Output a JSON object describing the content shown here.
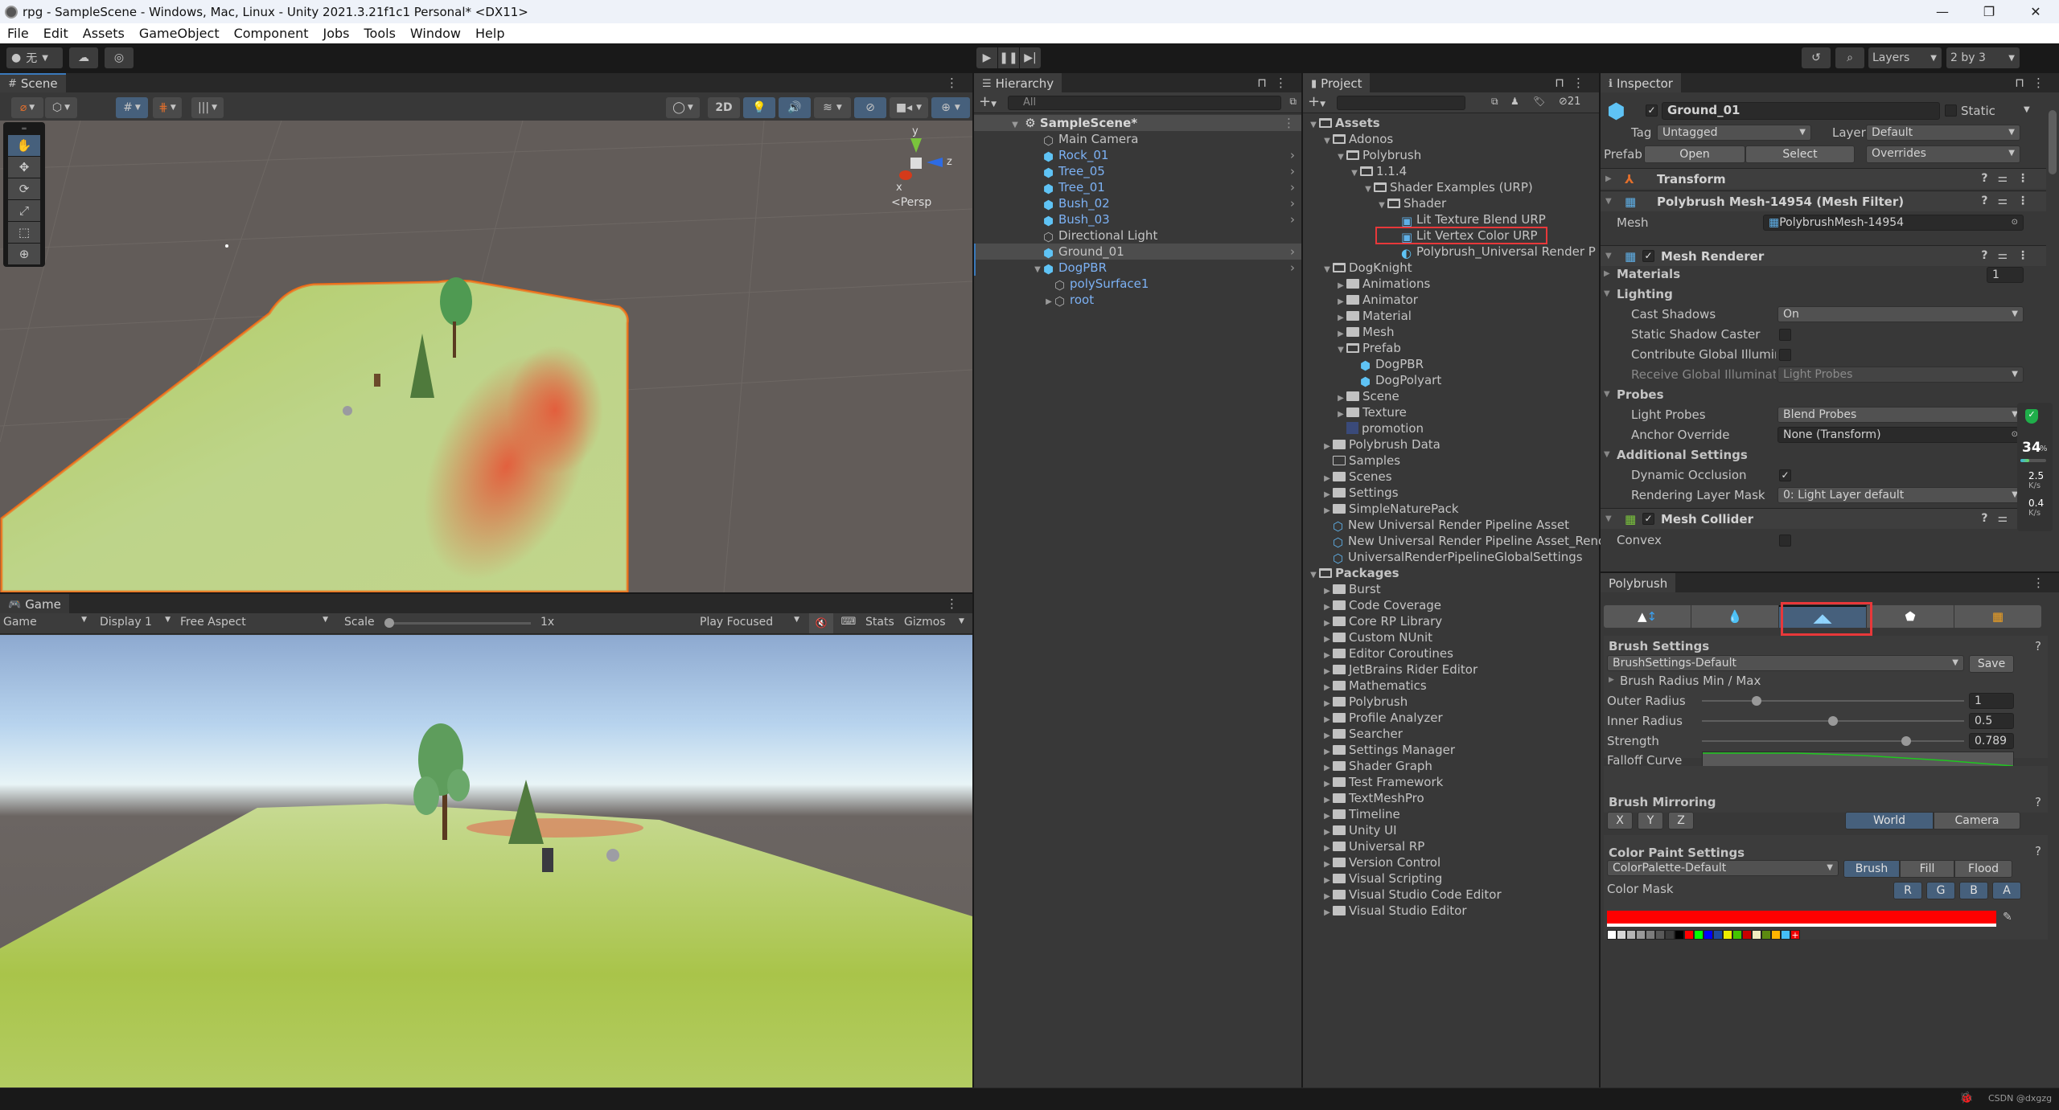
{
  "window": {
    "title": "rpg - SampleScene - Windows, Mac, Linux - Unity 2021.3.21f1c1 Personal* <DX11>",
    "controls": [
      "—",
      "❐",
      "✕"
    ]
  },
  "menu": [
    "File",
    "Edit",
    "Assets",
    "GameObject",
    "Component",
    "Jobs",
    "Tools",
    "Window",
    "Help"
  ],
  "toolbar": {
    "account_label": "无",
    "layers_label": "Layers",
    "layout_label": "2 by 3"
  },
  "scene": {
    "tab_label": "Scene",
    "btn_2d": "2D",
    "persp_label": "Persp",
    "gizmo_axes": {
      "x": "x",
      "y": "y",
      "z": "z"
    },
    "tools": [
      "hand-tool",
      "move-tool",
      "rotate-tool",
      "scale-tool",
      "rect-tool",
      "transform-tool"
    ]
  },
  "game": {
    "tab_label": "Game",
    "mode": "Game",
    "display": "Display 1",
    "aspect": "Free Aspect",
    "scale_label": "Scale",
    "scale_value": "1x",
    "play_mode": "Play Focused",
    "stats": "Stats",
    "gizmos": "Gizmos"
  },
  "hierarchy": {
    "tab_label": "Hierarchy",
    "search_placeholder": "All",
    "scene_name": "SampleScene*",
    "items": [
      {
        "label": "Main Camera",
        "prefab": false,
        "depth": 1,
        "chevron": false
      },
      {
        "label": "Rock_01",
        "prefab": true,
        "depth": 1,
        "chevron": true
      },
      {
        "label": "Tree_05",
        "prefab": true,
        "depth": 1,
        "chevron": true
      },
      {
        "label": "Tree_01",
        "prefab": true,
        "depth": 1,
        "chevron": true
      },
      {
        "label": "Bush_02",
        "prefab": true,
        "depth": 1,
        "chevron": true
      },
      {
        "label": "Bush_03",
        "prefab": true,
        "depth": 1,
        "chevron": true
      },
      {
        "label": "Directional Light",
        "prefab": false,
        "depth": 1,
        "chevron": false
      },
      {
        "label": "Ground_01",
        "prefab": true,
        "depth": 1,
        "chevron": true,
        "selected": true,
        "plain": true
      },
      {
        "label": "DogPBR",
        "prefab": true,
        "depth": 1,
        "chevron": true,
        "expanded": true
      },
      {
        "label": "polySurface1",
        "prefab": true,
        "depth": 2,
        "chevron": false,
        "child": true
      },
      {
        "label": "root",
        "prefab": true,
        "depth": 2,
        "chevron": false,
        "child": true,
        "collapsed": true
      }
    ]
  },
  "project": {
    "tab_label": "Project",
    "hidden_count": "21",
    "tree": [
      {
        "label": "Assets",
        "depth": 0,
        "type": "open",
        "bold": true
      },
      {
        "label": "Adonos",
        "depth": 1,
        "type": "open"
      },
      {
        "label": "Polybrush",
        "depth": 2,
        "type": "open"
      },
      {
        "label": "1.1.4",
        "depth": 3,
        "type": "open"
      },
      {
        "label": "Shader Examples (URP)",
        "depth": 4,
        "type": "open"
      },
      {
        "label": "Shader",
        "depth": 5,
        "type": "open"
      },
      {
        "label": "Lit Texture Blend URP",
        "depth": 6,
        "type": "shader"
      },
      {
        "label": "Lit Vertex Color URP",
        "depth": 6,
        "type": "shader",
        "highlighted": true
      },
      {
        "label": "Polybrush_Universal Render P",
        "depth": 6,
        "type": "material"
      },
      {
        "label": "DogKnight",
        "depth": 1,
        "type": "open"
      },
      {
        "label": "Animations",
        "depth": 2,
        "type": "closed"
      },
      {
        "label": "Animator",
        "depth": 2,
        "type": "closed"
      },
      {
        "label": "Material",
        "depth": 2,
        "type": "closed"
      },
      {
        "label": "Mesh",
        "depth": 2,
        "type": "closed"
      },
      {
        "label": "Prefab",
        "depth": 2,
        "type": "open"
      },
      {
        "label": "DogPBR",
        "depth": 3,
        "type": "prefab"
      },
      {
        "label": "DogPolyart",
        "depth": 3,
        "type": "prefab"
      },
      {
        "label": "Scene",
        "depth": 2,
        "type": "closed"
      },
      {
        "label": "Texture",
        "depth": 2,
        "type": "closed"
      },
      {
        "label": "promotion",
        "depth": 2,
        "type": "image"
      },
      {
        "label": "Polybrush Data",
        "depth": 1,
        "type": "closed"
      },
      {
        "label": "Samples",
        "depth": 1,
        "type": "empty"
      },
      {
        "label": "Scenes",
        "depth": 1,
        "type": "closed"
      },
      {
        "label": "Settings",
        "depth": 1,
        "type": "closed"
      },
      {
        "label": "SimpleNaturePack",
        "depth": 1,
        "type": "closed"
      },
      {
        "label": "New Universal Render Pipeline Asset",
        "depth": 1,
        "type": "asset"
      },
      {
        "label": "New Universal Render Pipeline Asset_Renderer",
        "depth": 1,
        "type": "asset"
      },
      {
        "label": "UniversalRenderPipelineGlobalSettings",
        "depth": 1,
        "type": "asset"
      },
      {
        "label": "Packages",
        "depth": 0,
        "type": "open",
        "bold": true
      },
      {
        "label": "Burst",
        "depth": 1,
        "type": "closed"
      },
      {
        "label": "Code Coverage",
        "depth": 1,
        "type": "closed"
      },
      {
        "label": "Core RP Library",
        "depth": 1,
        "type": "closed"
      },
      {
        "label": "Custom NUnit",
        "depth": 1,
        "type": "closed"
      },
      {
        "label": "Editor Coroutines",
        "depth": 1,
        "type": "closed"
      },
      {
        "label": "JetBrains Rider Editor",
        "depth": 1,
        "type": "closed"
      },
      {
        "label": "Mathematics",
        "depth": 1,
        "type": "closed"
      },
      {
        "label": "Polybrush",
        "depth": 1,
        "type": "closed"
      },
      {
        "label": "Profile Analyzer",
        "depth": 1,
        "type": "closed"
      },
      {
        "label": "Searcher",
        "depth": 1,
        "type": "closed"
      },
      {
        "label": "Settings Manager",
        "depth": 1,
        "type": "closed"
      },
      {
        "label": "Shader Graph",
        "depth": 1,
        "type": "closed"
      },
      {
        "label": "Test Framework",
        "depth": 1,
        "type": "closed"
      },
      {
        "label": "TextMeshPro",
        "depth": 1,
        "type": "closed"
      },
      {
        "label": "Timeline",
        "depth": 1,
        "type": "closed"
      },
      {
        "label": "Unity UI",
        "depth": 1,
        "type": "closed"
      },
      {
        "label": "Universal RP",
        "depth": 1,
        "type": "closed"
      },
      {
        "label": "Version Control",
        "depth": 1,
        "type": "closed"
      },
      {
        "label": "Visual Scripting",
        "depth": 1,
        "type": "closed"
      },
      {
        "label": "Visual Studio Code Editor",
        "depth": 1,
        "type": "closed"
      },
      {
        "label": "Visual Studio Editor",
        "depth": 1,
        "type": "closed"
      }
    ]
  },
  "inspector": {
    "tab_label": "Inspector",
    "object_name": "Ground_01",
    "active": true,
    "static_label": "Static",
    "tag_label": "Tag",
    "tag_value": "Untagged",
    "layer_label": "Layer",
    "layer_value": "Default",
    "prefab_label": "Prefab",
    "prefab_open": "Open",
    "prefab_select": "Select",
    "prefab_overrides": "Overrides",
    "transform": "Transform",
    "mesh_filter": "Polybrush Mesh-14954 (Mesh Filter)",
    "mesh_label": "Mesh",
    "mesh_value": "PolybrushMesh-14954",
    "mesh_renderer": "Mesh Renderer",
    "materials_label": "Materials",
    "materials_count": "1",
    "lighting": "Lighting",
    "cast_shadows_label": "Cast Shadows",
    "cast_shadows_value": "On",
    "static_shadow_label": "Static Shadow Caster",
    "contribute_gi_label": "Contribute Global Illuminat",
    "receive_gi_label": "Receive Global Illuminatio",
    "receive_gi_value": "Light Probes",
    "probes": "Probes",
    "light_probes_label": "Light Probes",
    "light_probes_value": "Blend Probes",
    "anchor_label": "Anchor Override",
    "anchor_value": "None (Transform)",
    "additional": "Additional Settings",
    "dynamic_occlusion_label": "Dynamic Occlusion",
    "rendering_layer_label": "Rendering Layer Mask",
    "rendering_layer_value": "0: Light Layer default",
    "mesh_collider": "Mesh Collider",
    "convex_label": "Convex"
  },
  "net_overlay": {
    "cpu_percent": "34",
    "percent_sign": "%",
    "up_value": "2.5",
    "up_unit": "K/s",
    "down_value": "0.4",
    "down_unit": "K/s",
    "cpu_fraction": 0.34
  },
  "polybrush": {
    "tab_label": "Polybrush",
    "modes": [
      "sculpt",
      "smooth",
      "paint-vertex-colors",
      "scatter-prefabs",
      "paint-textures"
    ],
    "active_mode": 2,
    "brush_settings_title": "Brush Settings",
    "brush_preset": "BrushSettings-Default",
    "save_label": "Save",
    "radius_minmax": "Brush Radius Min / Max",
    "outer_radius_label": "Outer Radius",
    "outer_radius_value": "1",
    "outer_radius_frac": 0.21,
    "inner_radius_label": "Inner Radius",
    "inner_radius_value": "0.5",
    "inner_radius_frac": 0.5,
    "strength_label": "Strength",
    "strength_value": "0.789",
    "strength_frac": 0.78,
    "falloff_label": "Falloff Curve",
    "mirroring_title": "Brush Mirroring",
    "mirror_axes": [
      "X",
      "Y",
      "Z"
    ],
    "mirror_world": "World",
    "mirror_camera": "Camera",
    "color_title": "Color Paint Settings",
    "palette": "ColorPalette-Default",
    "paint_brush": "Brush",
    "paint_fill": "Fill",
    "paint_flood": "Flood",
    "color_mask_label": "Color Mask",
    "mask_channels": [
      "R",
      "G",
      "B",
      "A"
    ],
    "current_color": "#ff0000",
    "swatches": [
      "#ffffff",
      "#d6d6d6",
      "#b4b4b4",
      "#999999",
      "#7c7c7c",
      "#595959",
      "#3c3c3c",
      "#000000",
      "#ff0000",
      "#00ff00",
      "#0000ff",
      "#1f4aa0",
      "#ecec00",
      "#44c500",
      "#cc0000",
      "#f0ecc0",
      "#5c8a10",
      "#ffb400",
      "#44bdf6"
    ]
  },
  "statusbar": {
    "watermark": "CSDN @dxgzg"
  }
}
